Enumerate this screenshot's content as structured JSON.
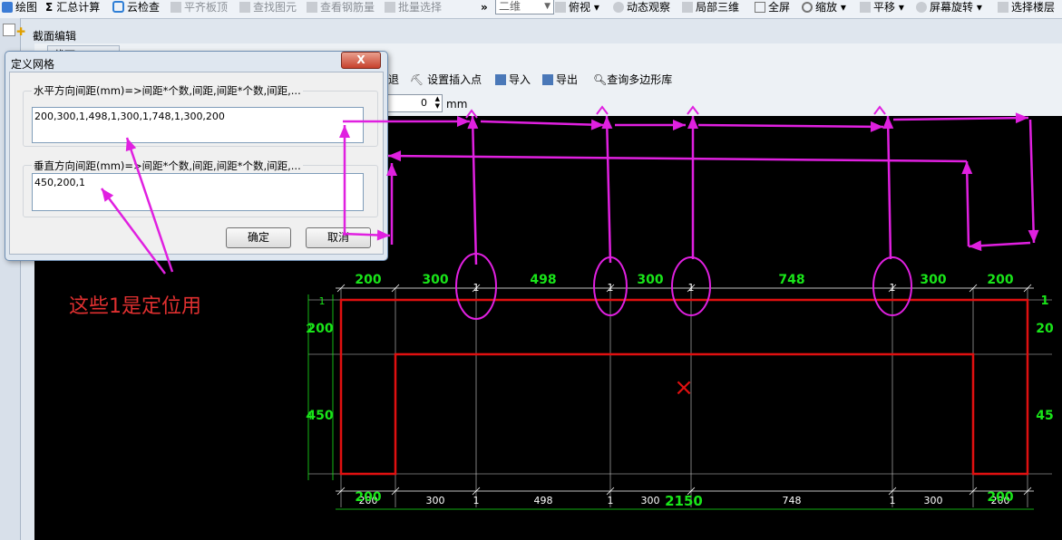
{
  "toolbar": {
    "items": [
      {
        "label": "绘图",
        "icon": "draw-icon",
        "dim": false
      },
      {
        "label": "汇总计算",
        "icon": "sigma-icon",
        "dim": false
      },
      {
        "label": "云检查",
        "icon": "cloud-check-icon",
        "dim": false
      },
      {
        "label": "平齐板顶",
        "icon": "align-slab-icon",
        "dim": true
      },
      {
        "label": "查找图元",
        "icon": "find-icon",
        "dim": true
      },
      {
        "label": "查看钢筋量",
        "icon": "rebar-qty-icon",
        "dim": true
      },
      {
        "label": "批量选择",
        "icon": "batch-select-icon",
        "dim": true
      }
    ],
    "overflow": "»",
    "view_select": "二维",
    "view_items": [
      "俯视",
      "动态观察",
      "局部三维",
      "全屏",
      "缩放",
      "平移",
      "屏幕旋转",
      "选择楼层"
    ]
  },
  "section_editor": {
    "title": "截面编辑",
    "tab_label": "截面",
    "toolbar": {
      "back_label": "退",
      "set_insert_point": "设置插入点",
      "import": "导入",
      "export": "导出",
      "query_polygon_lib": "查询多边形库"
    },
    "offset_value": "0",
    "unit": "mm"
  },
  "dialog": {
    "title": "定义网格",
    "close_symbol": "X",
    "horizontal_label": "水平方向间距(mm)=>间距*个数,间距,间距*个数,间距,...",
    "horizontal_value": "200,300,1,498,1,300,1,748,1,300,200",
    "vertical_label": "垂直方向间距(mm)=>间距*个数,间距,间距*个数,间距,...",
    "vertical_value": "450,200,1",
    "ok_label": "确定",
    "cancel_label": "取消"
  },
  "annotation": {
    "note": "这些1是定位用"
  },
  "drawing": {
    "top_dims": [
      "200",
      "300",
      "1",
      "498",
      "1",
      "300",
      "1",
      "748",
      "1",
      "300",
      "200"
    ],
    "bottom_dims": [
      "200",
      "300",
      "1",
      "498",
      "1",
      "300",
      "748",
      "1",
      "300",
      "200"
    ],
    "bottom_overlap": [
      "200",
      "200"
    ],
    "total_width": "2150",
    "left_dims": [
      "1",
      "200",
      "450"
    ],
    "left_overlap": [
      "2",
      "4"
    ],
    "right_dims": [
      "1",
      "20",
      "45"
    ],
    "colors": {
      "dim": "#19e519",
      "outline": "#e01010",
      "arrow": "#e020e0",
      "grid": "#cfcfcf",
      "dimline": "#ffffff"
    }
  }
}
